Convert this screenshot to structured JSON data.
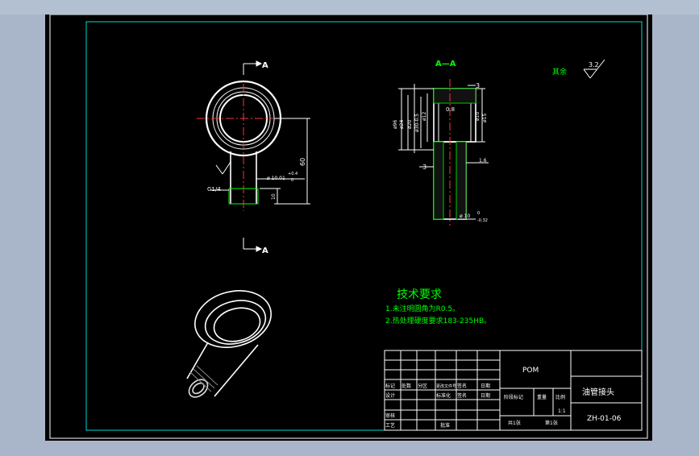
{
  "drawing": {
    "section_marks": {
      "top_label": "A",
      "bottom_label": "A",
      "section_title": "A—A"
    },
    "dimensions": {
      "overall_height": "60",
      "thread": "G1/4",
      "bore": "ø 10.01",
      "bore_tol_upper": "+0.4",
      "bore_tol_lower": "0",
      "thread_length": "10",
      "tip_dim": "3",
      "hole_dim": "ø 10",
      "hole_tol_upper": "0",
      "hole_tol_lower": "-0.32",
      "right_small": "1.6",
      "left_small": "3",
      "chamfer_note": "0.8",
      "d1": "ø96",
      "d2": "ø24",
      "d3": "ø20",
      "d4": "ø30-0.5",
      "d5": "ø12",
      "d6": "ø10",
      "d7": "ø15"
    },
    "surface_finish": {
      "label": "其余",
      "value": "3.2"
    },
    "tech_requirements": {
      "title": "技术要求",
      "item1": "1.未注明圆角为R0.5。",
      "item2": "2.热处理硬度要求183-235HB。"
    },
    "title_block": {
      "material": "POM",
      "part_name": "油管接头",
      "drawing_no": "ZH-01-06",
      "scale_val": "1:1",
      "h_mark": "标记",
      "h_count": "处数",
      "h_zone": "分区",
      "h_doc": "更改文件号",
      "h_sign": "签名",
      "h_date": "日期",
      "h_design": "设计",
      "h_std": "标准化",
      "h_sign2": "签名",
      "h_date2": "日期",
      "h_stage": "阶段标记",
      "h_weight": "重量",
      "h_scale": "比例",
      "h_review": "审核",
      "h_process": "工艺",
      "h_approve": "批准",
      "h_sheets": "共1张",
      "h_sheet": "第1张"
    }
  }
}
